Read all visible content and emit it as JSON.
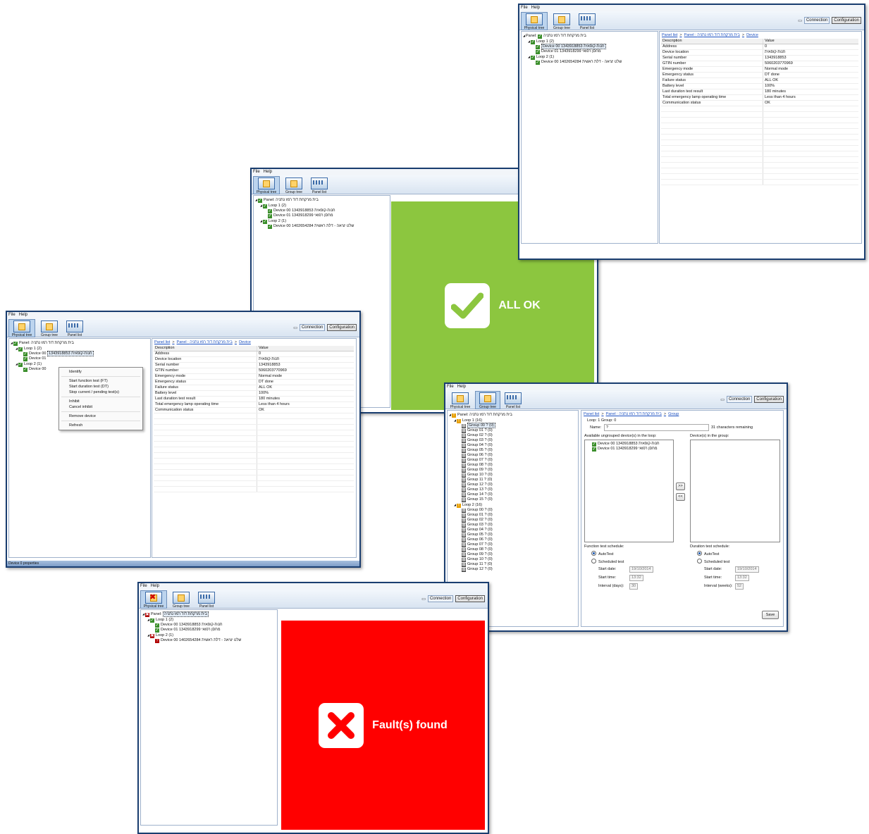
{
  "menu": {
    "file": "File",
    "help": "Help"
  },
  "toolbar": {
    "physical": "Physical tree",
    "group": "Group tree",
    "panel": "Panel list",
    "connection": "Connection",
    "configuration": "Configuration"
  },
  "tree": {
    "panel_prefix": "Panel:",
    "panel_name": "בית מרקחת דוד רמז נתניה",
    "loop1": "Loop 1 (2)",
    "loop2": "Loop 2 (1)",
    "dev00_id": "Device 00",
    "dev00_serial": "1343918853",
    "dev00_loc": "חנות-קופאית",
    "dev01_id": "Device 01",
    "dev01_serial": "1343918299",
    "dev01_loc": "מחסן רפואי",
    "loop2_dev_id": "Device 00",
    "loop2_dev_serial": "1402654284",
    "loop2_dev_loc": "שלט יציאה - דלת ראשית"
  },
  "breadcrumb": {
    "panel_list": "Panel list",
    "sep": ">",
    "panel_label": "Panel : בית מרקחת דוד רמז נתניה",
    "device": "Device",
    "group": "Group"
  },
  "props": {
    "head_desc": "Description",
    "head_value": "Value",
    "rows": [
      {
        "d": "Address",
        "v": "0"
      },
      {
        "d": "Device location",
        "v": "חנות-קופאית"
      },
      {
        "d": "Serial number",
        "v": "1343918853"
      },
      {
        "d": "GTIN number",
        "v": "5060203770969"
      },
      {
        "d": "Emergency mode",
        "v": "Normal mode"
      },
      {
        "d": "Emergency status",
        "v": "DT done"
      },
      {
        "d": "Failure status",
        "v": "ALL OK"
      },
      {
        "d": "Battery level",
        "v": "100%"
      },
      {
        "d": "Last duration test result",
        "v": "180 minutes"
      },
      {
        "d": "Total emergency lamp operating time",
        "v": "Less than 4 hours"
      },
      {
        "d": "Communication status",
        "v": "OK"
      }
    ]
  },
  "status_ok": "ALL OK",
  "status_fault": "Fault(s) found",
  "statusbar": "Device 0 properties",
  "context_menu": [
    "Identify",
    "Start function test (FT)",
    "Start duration test (DT)",
    "Stop current / pending test(s)",
    "Inhibit",
    "Cancel inhibit",
    "Remove device",
    "Refresh"
  ],
  "group": {
    "loop1": "Loop 1 (16)",
    "loop2": "Loop 2 (16)",
    "loop_group": "Loop: 1  Group: 0",
    "name_label": "Name:",
    "name_value": "?",
    "remaining": "31 characters remaining",
    "available": "Available ungrouped device(s) in the loop:",
    "in_group": "Device(s) in the group:",
    "move_right": ">>",
    "move_left": "<<",
    "ft_title": "Function test schedule:",
    "dt_title": "Duration test schedule:",
    "auto": "AutoTest",
    "scheduled": "Scheduled test",
    "start_date": "Start date:",
    "start_time": "Start time:",
    "interval_days": "Interval (days):",
    "interval_weeks": "Interval (weeks):",
    "date_value": "19/10/2014",
    "time_value": "13:32",
    "days_value": "30",
    "weeks_value": "52",
    "save": "Save",
    "loop1_groups": [
      "Group 00  ? (0)",
      "Group 01  ? (0)",
      "Group 02  ? (0)",
      "Group 03  ? (0)",
      "Group 04  ? (0)",
      "Group 05  ? (0)",
      "Group 06  ? (0)",
      "Group 07  ? (0)",
      "Group 08  ? (0)",
      "Group 09  ? (0)",
      "Group 10  ? (0)",
      "Group 11  ? (0)",
      "Group 12  ? (0)",
      "Group 13  ? (0)",
      "Group 14  ? (0)",
      "Group 15  ? (0)"
    ],
    "loop2_groups": [
      "Group 00  ? (0)",
      "Group 01  ? (0)",
      "Group 02  ? (0)",
      "Group 03  ? (0)",
      "Group 04  ? (0)",
      "Group 05  ? (0)",
      "Group 06  ? (0)",
      "Group 07  ? (0)",
      "Group 08  ? (0)",
      "Group 09  ? (0)",
      "Group 10  ? (0)",
      "Group 11  ? (0)",
      "Group 12  ? (0)"
    ]
  },
  "colors": {
    "ok_green": "#8cc63f",
    "fault_red": "#ff0000"
  }
}
